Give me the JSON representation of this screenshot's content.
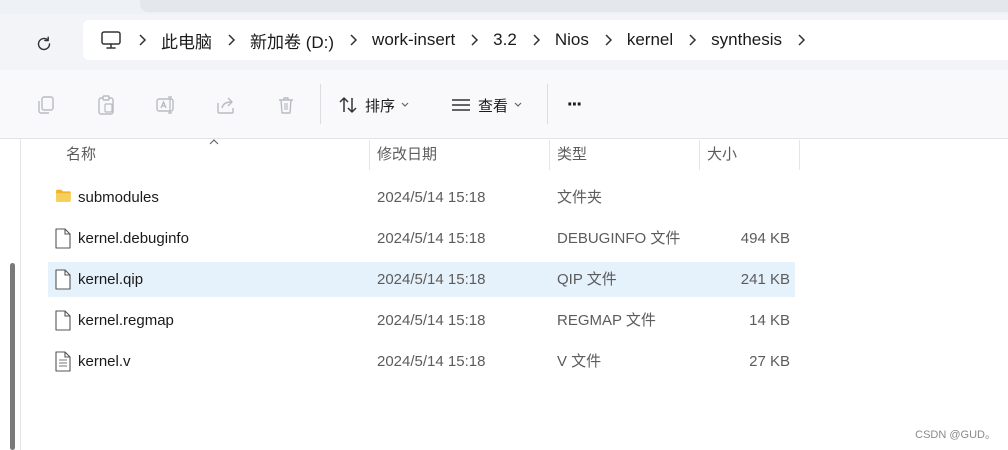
{
  "address": {
    "breadcrumb": [
      "此电脑",
      "新加卷 (D:)",
      "work-insert",
      "3.2",
      "Nios",
      "kernel",
      "synthesis"
    ],
    "icon": "computer-icon"
  },
  "toolbar": {
    "sort_label": "排序",
    "view_label": "查看",
    "more_label": "···"
  },
  "columns": {
    "name": "名称",
    "date": "修改日期",
    "type": "类型",
    "size": "大小"
  },
  "files": [
    {
      "name": "submodules",
      "date": "2024/5/14 15:18",
      "type": "文件夹",
      "size": "",
      "icon": "folder-icon"
    },
    {
      "name": "kernel.debuginfo",
      "date": "2024/5/14 15:18",
      "type": "DEBUGINFO 文件",
      "size": "494 KB",
      "icon": "file-icon"
    },
    {
      "name": "kernel.qip",
      "date": "2024/5/14 15:18",
      "type": "QIP 文件",
      "size": "241 KB",
      "icon": "file-icon",
      "selected": true
    },
    {
      "name": "kernel.regmap",
      "date": "2024/5/14 15:18",
      "type": "REGMAP 文件",
      "size": "14 KB",
      "icon": "file-icon"
    },
    {
      "name": "kernel.v",
      "date": "2024/5/14 15:18",
      "type": "V 文件",
      "size": "27 KB",
      "icon": "text-file-icon"
    }
  ],
  "watermark": "CSDN @GUD。",
  "colors": {
    "selection": "#e5f1fb",
    "folder": "#f5c242",
    "toolbar_bg": "#f9f9fb"
  }
}
